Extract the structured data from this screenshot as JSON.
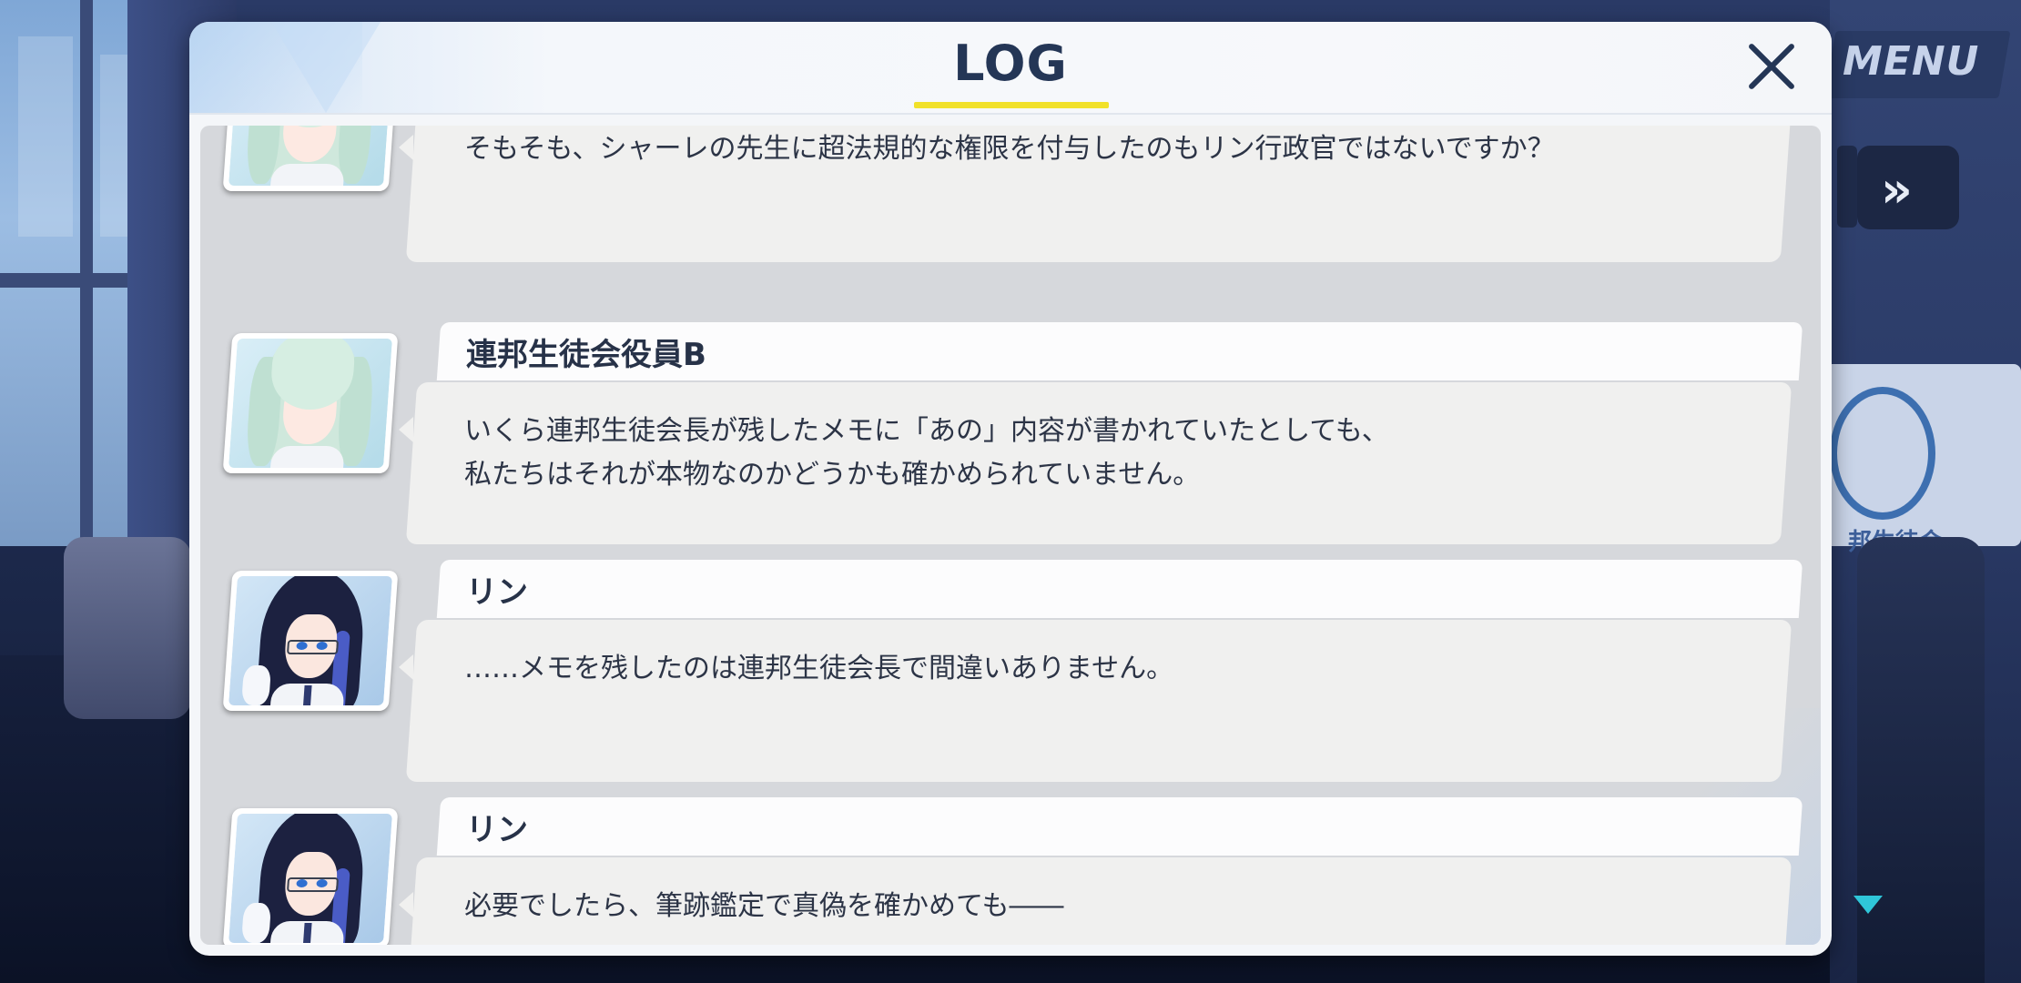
{
  "header": {
    "title": "LOG",
    "close_icon": "close-icon"
  },
  "hud": {
    "menu_label": "MENU",
    "skip_icon": "fast-forward-icon",
    "scroll_icon": "scroll-down-icon"
  },
  "entries": [
    {
      "speaker": "",
      "message": "そもそも、シャーレの先生に超法規的な権限を付与したのもリン行政官ではないですか？",
      "avatar": "mint-hair-student-avatar"
    },
    {
      "speaker": "連邦生徒会役員B",
      "message": "いくら連邦生徒会長が残したメモに「あの」内容が書かれていたとしても、\n私たちはそれが本物なのかどうかも確かめられていません。",
      "avatar": "mint-hair-student-avatar"
    },
    {
      "speaker": "リン",
      "message": "……メモを残したのは連邦生徒会長で間違いありません。",
      "avatar": "rin-avatar"
    },
    {
      "speaker": "リン",
      "message": "必要でしたら、筆跡鑑定で真偽を確かめても――",
      "avatar": "rin-avatar"
    }
  ],
  "colors": {
    "title": "#243656",
    "title_underline": "#f1e12a",
    "bubble": "#f0f0ef",
    "namebar": "#fcfcfd",
    "scroll_arrow": "#2fc6d9"
  },
  "background_emblem_text": "邦生徒会"
}
